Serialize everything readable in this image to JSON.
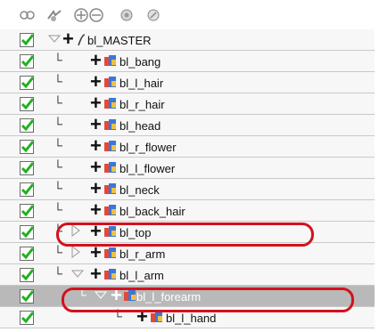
{
  "toolbar": {
    "buttons": [
      {
        "icon": "show-all-icon"
      },
      {
        "icon": "hide-all-icon"
      },
      {
        "icon": "expand-icon"
      },
      {
        "icon": "collapse-icon"
      },
      {
        "icon": "layers-icon"
      },
      {
        "icon": "peg-icon"
      }
    ]
  },
  "tree": {
    "rows": [
      {
        "label": "bl_MASTER"
      },
      {
        "label": "bl_bang"
      },
      {
        "label": "bl_l_hair"
      },
      {
        "label": "bl_r_hair"
      },
      {
        "label": "bl_head"
      },
      {
        "label": "bl_r_flower"
      },
      {
        "label": "bl_l_flower"
      },
      {
        "label": "bl_neck"
      },
      {
        "label": "bl_back_hair"
      },
      {
        "label": "bl_top"
      },
      {
        "label": "bl_r_arm"
      },
      {
        "label": "bl_l_arm"
      },
      {
        "label": "bl_l_forearm"
      },
      {
        "label": "bl_l_hand"
      }
    ]
  },
  "colors": {
    "check": "#22b022",
    "highlight": "#d3111d",
    "selected_row": "#b9b9b9"
  }
}
